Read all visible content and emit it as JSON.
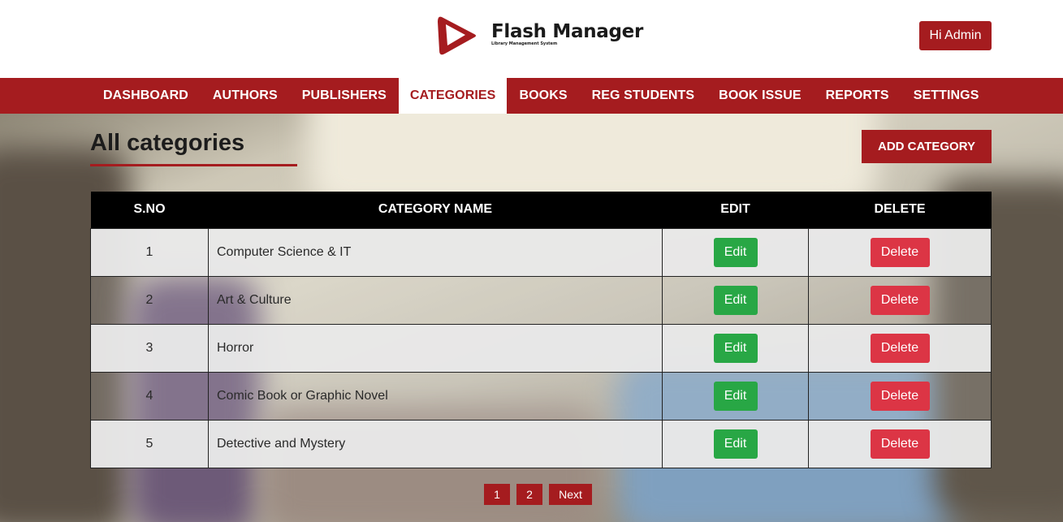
{
  "header": {
    "logo_title": "Flash Manager",
    "logo_subtitle": "Library Management System",
    "user_button": "Hi Admin"
  },
  "nav": {
    "items": [
      "DASHBOARD",
      "AUTHORS",
      "PUBLISHERS",
      "CATEGORIES",
      "BOOKS",
      "REG STUDENTS",
      "BOOK ISSUE",
      "REPORTS",
      "SETTINGS"
    ],
    "active": "CATEGORIES"
  },
  "page": {
    "title": "All categories",
    "add_button": "ADD CATEGORY"
  },
  "table": {
    "headers": [
      "S.NO",
      "CATEGORY NAME",
      "EDIT",
      "DELETE"
    ],
    "rows": [
      {
        "sno": "1",
        "name": "Computer Science & IT",
        "edit": "Edit",
        "delete": "Delete"
      },
      {
        "sno": "2",
        "name": "Art & Culture",
        "edit": "Edit",
        "delete": "Delete"
      },
      {
        "sno": "3",
        "name": "Horror",
        "edit": "Edit",
        "delete": "Delete"
      },
      {
        "sno": "4",
        "name": "Comic Book or Graphic Novel",
        "edit": "Edit",
        "delete": "Delete"
      },
      {
        "sno": "5",
        "name": "Detective and Mystery",
        "edit": "Edit",
        "delete": "Delete"
      }
    ]
  },
  "pagination": {
    "pages": [
      "1",
      "2"
    ],
    "next": "Next"
  },
  "colors": {
    "brand": "#a51c1f",
    "edit": "#28a745",
    "delete": "#dc3545"
  }
}
